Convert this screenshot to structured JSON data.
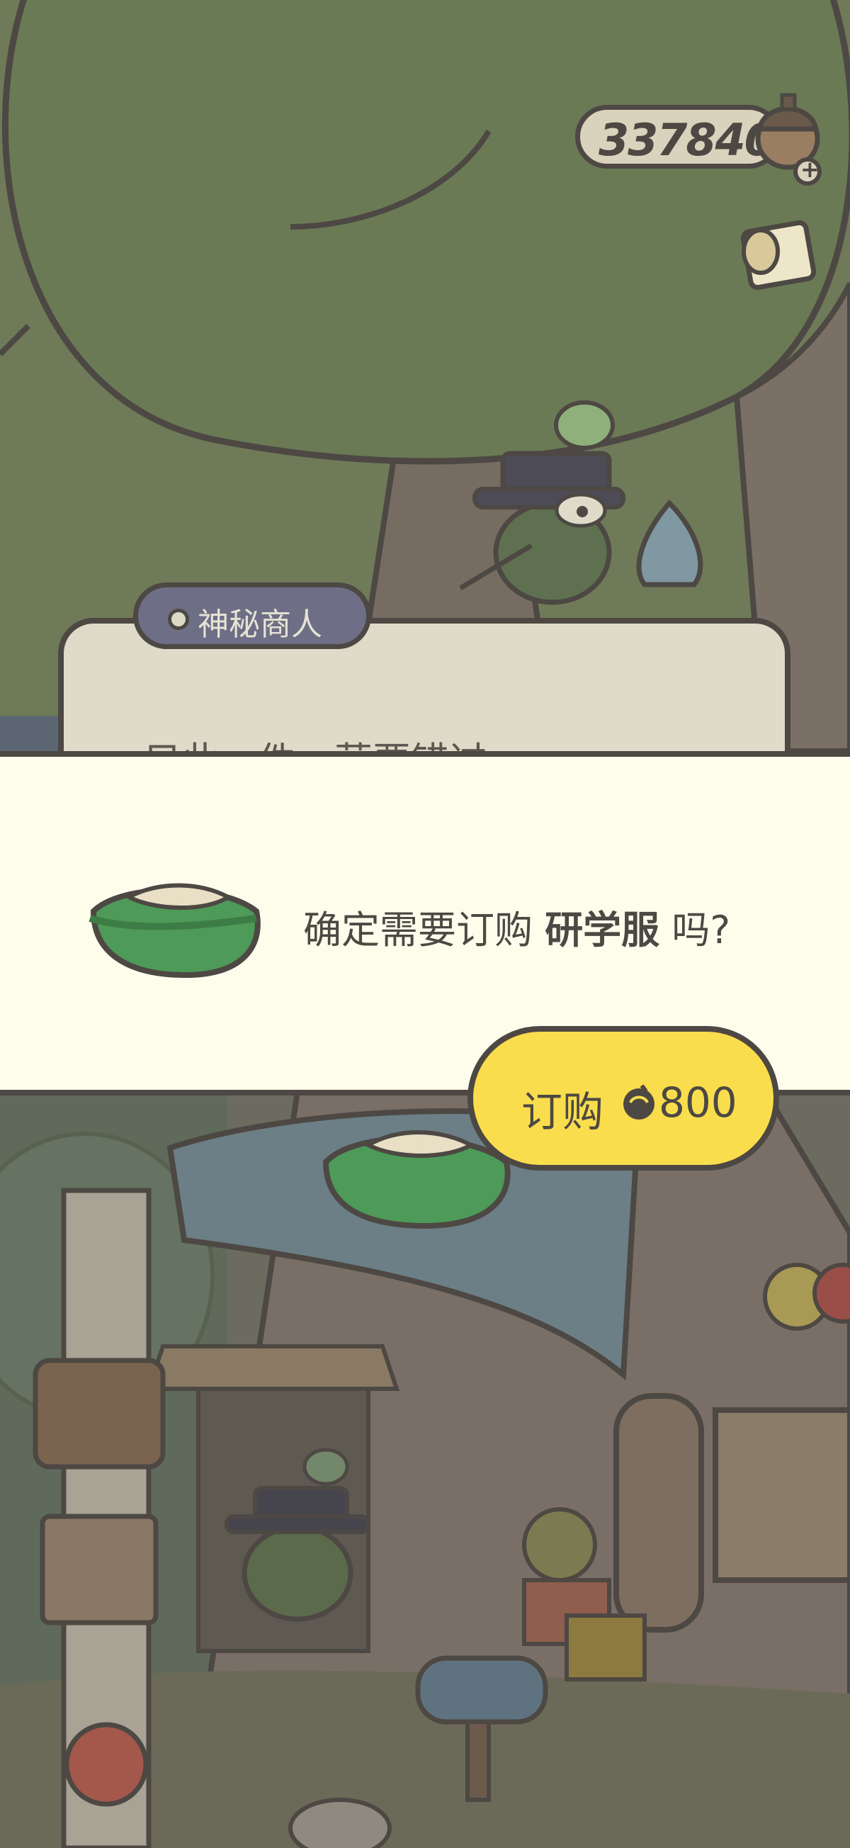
{
  "currency": {
    "count": "337840",
    "icon": "acorn-icon"
  },
  "scene_top": {
    "speaker_name": "神秘商人",
    "dialog_text": "只此一件，莫要错过"
  },
  "confirm": {
    "prefix": "确定需要订购 ",
    "item_name": "研学服",
    "suffix": " 吗?",
    "item_icon": "study-uniform-icon"
  },
  "buy_button": {
    "label": "订购",
    "price": "800",
    "price_icon": "acorn-icon"
  },
  "colors": {
    "outline": "#4d4843",
    "panel": "#fefdec",
    "button": "#f9dd4c",
    "speaker_tag": "#6e6e86"
  }
}
